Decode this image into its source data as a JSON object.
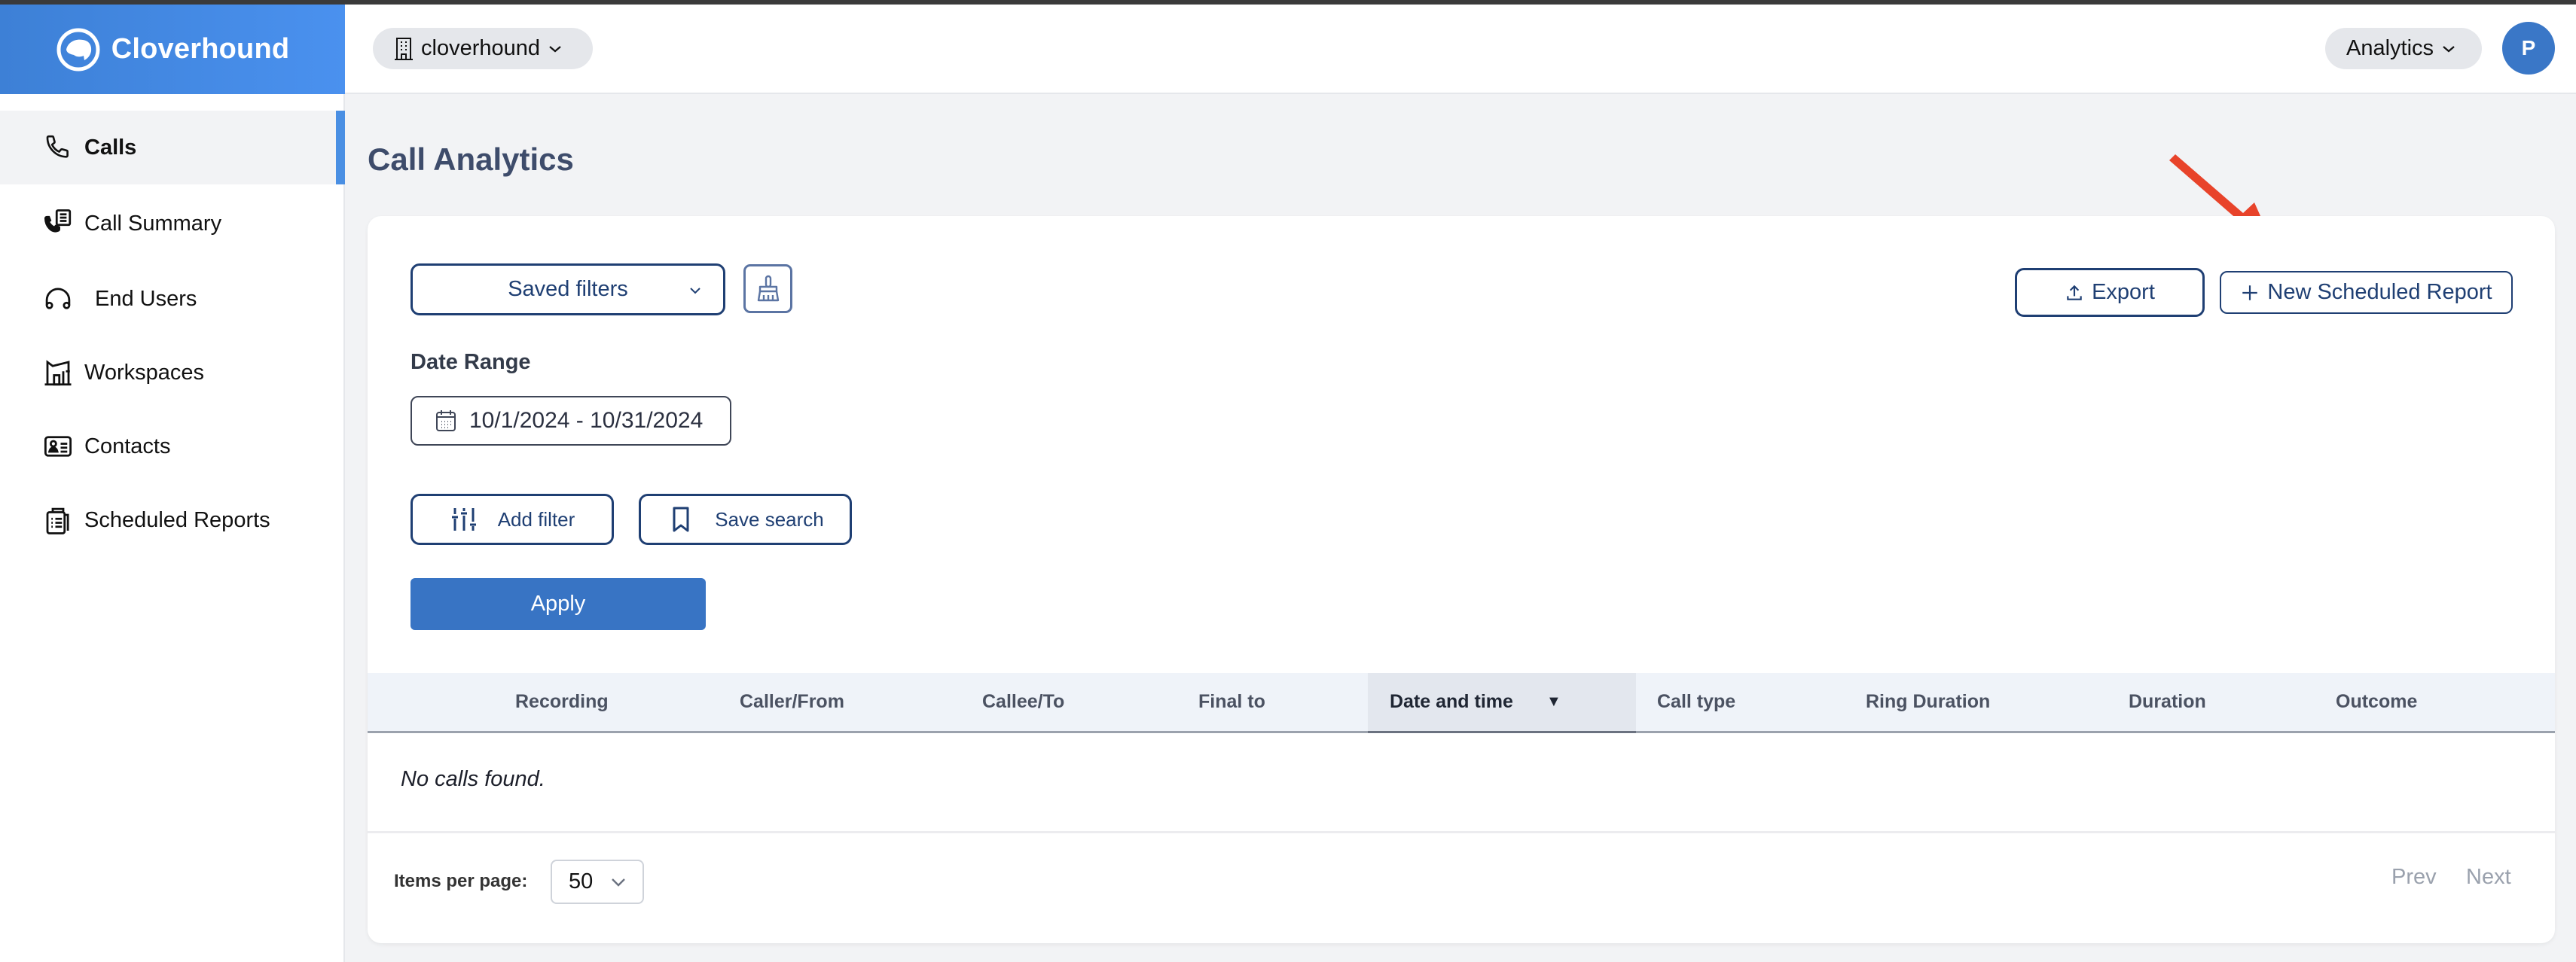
{
  "app": {
    "brand": "Cloverhound",
    "org_selector": "cloverhound",
    "module_selector": "Analytics",
    "user_initial": "P"
  },
  "sidebar": {
    "items": [
      {
        "label": "Calls",
        "icon": "phone-icon",
        "active": true
      },
      {
        "label": "Call Summary",
        "icon": "call-summary-icon",
        "active": false
      },
      {
        "label": "End Users",
        "icon": "headphones-icon",
        "active": false
      },
      {
        "label": "Workspaces",
        "icon": "workspace-building-icon",
        "active": false
      },
      {
        "label": "Contacts",
        "icon": "contact-card-icon",
        "active": false
      },
      {
        "label": "Scheduled Reports",
        "icon": "clipboard-icon",
        "active": false
      }
    ]
  },
  "page": {
    "title": "Call Analytics"
  },
  "filters": {
    "saved_filters_label": "Saved filters",
    "clear_icon": "brush-icon",
    "export_label": "Export",
    "new_report_label": "New Scheduled Report",
    "date_range_label": "Date Range",
    "date_range_value": "10/1/2024 - 10/31/2024",
    "add_filter_label": "Add filter",
    "save_search_label": "Save search",
    "apply_label": "Apply"
  },
  "table": {
    "columns": [
      {
        "label": "Recording"
      },
      {
        "label": "Caller/From"
      },
      {
        "label": "Callee/To"
      },
      {
        "label": "Final to"
      },
      {
        "label": "Date and time",
        "sorted": "desc",
        "sort_glyph": "▼"
      },
      {
        "label": "Call type"
      },
      {
        "label": "Ring Duration"
      },
      {
        "label": "Duration"
      },
      {
        "label": "Outcome"
      }
    ],
    "empty_message": "No calls found.",
    "rows": []
  },
  "pagination": {
    "items_per_page_label": "Items per page:",
    "items_per_page_value": "50",
    "prev_label": "Prev",
    "next_label": "Next"
  },
  "colors": {
    "brand_blue": "#4a8fe3",
    "primary_button": "#3874c4",
    "outline_navy": "#1f3f73",
    "annotation_arrow": "#e8432a"
  }
}
